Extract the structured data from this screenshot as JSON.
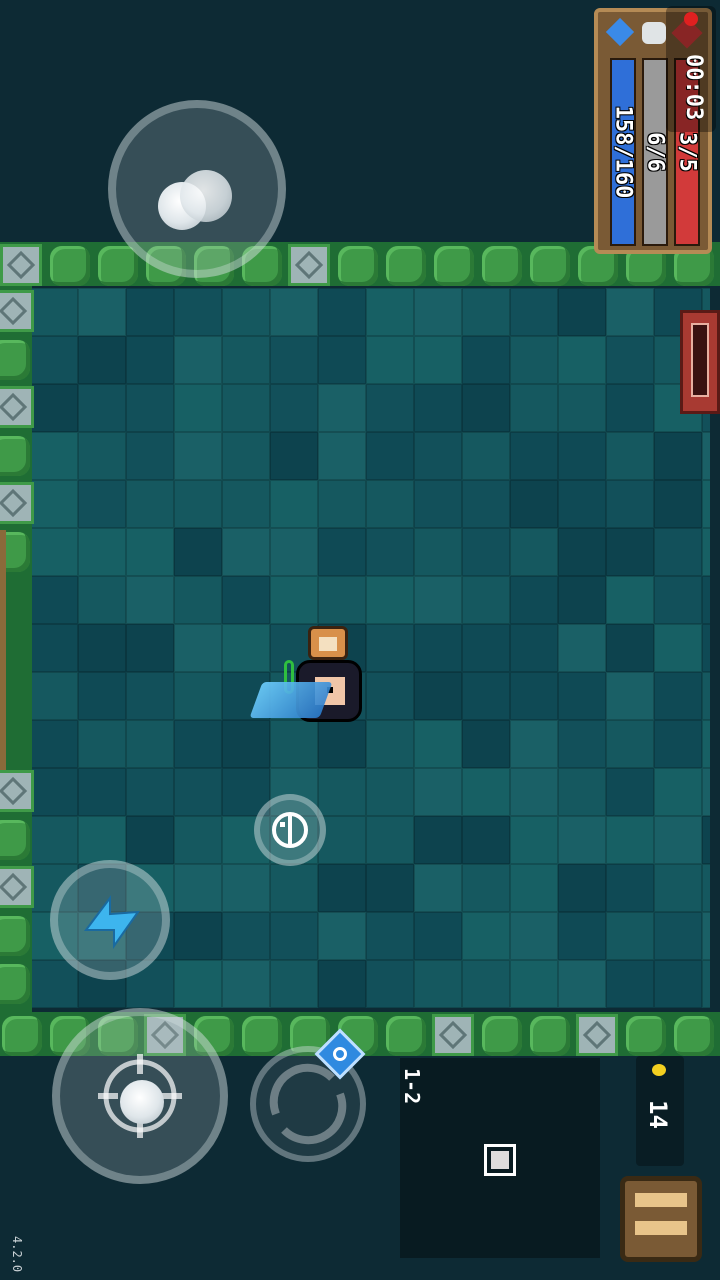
{
  "hud": {
    "energy": "158/160",
    "armor": "6/6",
    "health": "3/5",
    "timer": "00:03",
    "coins": "14",
    "level": "1-2",
    "version": "4.2.0"
  },
  "icons": {
    "energy": "diamond-icon",
    "armor": "shield-icon",
    "health": "heart-icon",
    "recording": "record-icon",
    "coin": "coin-icon",
    "skill": "lightning-icon",
    "emote": "smile-icon",
    "swap": "swap-weapon-icon",
    "pause": "pause-icon",
    "minimap_room": "room-icon"
  },
  "colors": {
    "energy": "#2f6fd8",
    "armor": "#9a9a9a",
    "health": "#d23a3a",
    "floor": "#12505a",
    "wall": "#3f9a48"
  }
}
